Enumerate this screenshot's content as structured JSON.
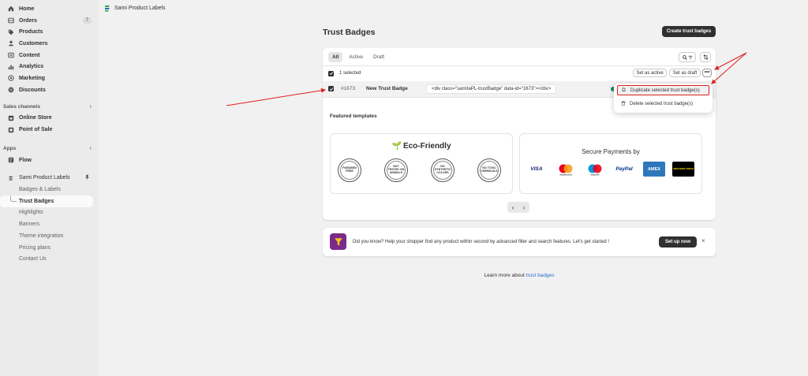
{
  "sidebar": {
    "items": [
      {
        "label": "Home",
        "icon": "home-icon"
      },
      {
        "label": "Orders",
        "icon": "orders-icon",
        "count": "7"
      },
      {
        "label": "Products",
        "icon": "tag-icon"
      },
      {
        "label": "Customers",
        "icon": "person-icon"
      },
      {
        "label": "Content",
        "icon": "content-icon"
      },
      {
        "label": "Analytics",
        "icon": "chart-icon"
      },
      {
        "label": "Marketing",
        "icon": "target-icon"
      },
      {
        "label": "Discounts",
        "icon": "discount-icon"
      }
    ],
    "sales_channels_label": "Sales channels",
    "channels": [
      {
        "label": "Online Store",
        "icon": "store-icon"
      },
      {
        "label": "Point of Sale",
        "icon": "pos-icon"
      }
    ],
    "apps_label": "Apps",
    "apps": [
      {
        "label": "Flow",
        "icon": "flow-icon"
      }
    ],
    "app_name": "Sami Product Labels",
    "app_sub": [
      "Badges & Labels",
      "Trust Badges",
      "Highlights",
      "Banners",
      "Theme integration",
      "Pricing plans",
      "Contact Us"
    ],
    "active_sub": "Trust Badges"
  },
  "topbar": {
    "app_title": "Sami Product Labels"
  },
  "page": {
    "title": "Trust Badges",
    "create_button": "Create trust badges"
  },
  "tabs": [
    "All",
    "Active",
    "Draft"
  ],
  "active_tab": "All",
  "bulk": {
    "selected_text": "1 selected",
    "set_active": "Set as active",
    "set_draft": "Set as draft",
    "more": "•••"
  },
  "row": {
    "id": "#1673",
    "name": "New Trust Badge",
    "code": "<div class=\"samitaPL-trustBadge\" data-id=\"1673\"></div>"
  },
  "dropdown": {
    "duplicate": "Duplicate selected trust badge(s)",
    "delete": "Delete selected trust badge(s)"
  },
  "featured": {
    "title": "Featured templates",
    "eco": {
      "title": "Eco-Friendly",
      "badges": [
        "PARABEN FREE",
        "NOT TESTED ON ANIMALS",
        "NO SYNTHETIC COLORS",
        "NO TOXIC CHEMICALS"
      ]
    },
    "payments": {
      "title": "Secure Payments by",
      "cards": [
        "VISA",
        "mastercard",
        "maestro",
        "PayPal",
        "AMEX",
        "WESTERN UNION"
      ]
    }
  },
  "pager": {
    "prev": "‹",
    "next": "›"
  },
  "banner": {
    "message": "Did you know? Help your shopper find any product within second by advanced filter and search features. Let's get started !",
    "button": "Set up now",
    "close": "×"
  },
  "learn": {
    "prefix": "Learn more about",
    "link": "trust badges"
  },
  "colors": {
    "accent_dark": "#303030",
    "link": "#2c6ecb",
    "highlight_red": "#e01e1e",
    "status_green": "#29845a"
  }
}
